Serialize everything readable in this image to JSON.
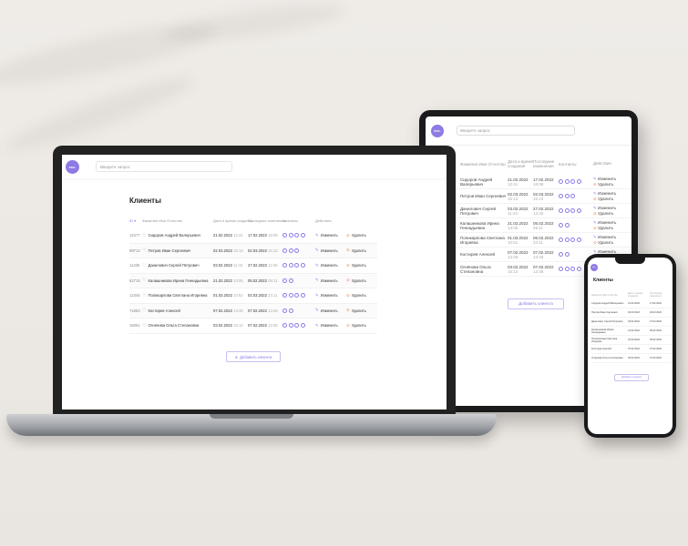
{
  "app": {
    "logo_text": "ecc.",
    "search_placeholder": "Введите запрос",
    "page_title": "Клиенты",
    "add_button_label": "Добавить клиента",
    "accent_color": "#8f7ae4",
    "delete_color": "#e98b6a"
  },
  "laptop": {
    "columns": [
      "ID ▾",
      "Фамилия Имя Отчество",
      "Дата и время создания",
      "Последние изменения",
      "Контакты",
      "Действия"
    ],
    "rows": [
      {
        "id": "12477",
        "name": "Сидоров Андрей Валерьевич",
        "created_date": "21.02.2022",
        "created_time": "12:41",
        "changed_date": "17.02.2022",
        "changed_time": "18:08",
        "edit": "Изменить",
        "delete": "Удалить"
      },
      {
        "id": "98713",
        "name": "Петров Иван Сергеевич",
        "created_date": "02.03.2022",
        "created_time": "15:13",
        "changed_date": "02.03.2022",
        "changed_time": "15:13",
        "edit": "Изменить",
        "delete": "Удалить"
      },
      {
        "id": "11435",
        "name": "Данилович Сергей Петрович",
        "created_date": "03.02.2022",
        "created_time": "11:44",
        "changed_date": "27.02.2022",
        "changed_time": "12:45",
        "edit": "Изменить",
        "delete": "Удалить"
      },
      {
        "id": "62715",
        "name": "Калашникова Ирина Геннадьевна",
        "created_date": "21.02.2022",
        "created_time": "13:05",
        "changed_date": "05.02.2022",
        "changed_time": "09:11",
        "edit": "Изменить",
        "delete": "Удалить"
      },
      {
        "id": "12346",
        "name": "Поликарпова Светлана Игоревна",
        "created_date": "01.03.2022",
        "created_time": "10:51",
        "changed_date": "02.03.2022",
        "changed_time": "23:11",
        "edit": "Изменить",
        "delete": "Удалить"
      },
      {
        "id": "71653",
        "name": "Костирев Алексей",
        "created_date": "07.02.2022",
        "created_time": "13:48",
        "changed_date": "07.02.2022",
        "changed_time": "13:48",
        "edit": "Изменить",
        "delete": "Удалить"
      },
      {
        "id": "15051",
        "name": "Огнёнова Ольга Степановна",
        "created_date": "03.02.2022",
        "created_time": "15:13",
        "changed_date": "07.02.2022",
        "changed_time": "13:38",
        "edit": "Изменить",
        "delete": "Удалить"
      }
    ]
  },
  "tablet": {
    "columns": [
      "Фамилия Имя Отчество",
      "Дата и время создания",
      "Последние изменения",
      "Контакты",
      "Действия"
    ],
    "rows": [
      {
        "name": "Сидоров Андрей Валерьевич",
        "created_date": "21.02.2022",
        "created_time": "12:41",
        "changed_date": "17.02.2022",
        "changed_time": "18:08",
        "edit": "Изменить",
        "delete": "Удалить"
      },
      {
        "name": "Петров Иван Сергеевич",
        "created_date": "02.03.2022",
        "created_time": "15:13",
        "changed_date": "02.03.2022",
        "changed_time": "15:13",
        "edit": "Изменить",
        "delete": "Удалить"
      },
      {
        "name": "Данилович Сергей Петрович",
        "created_date": "03.02.2022",
        "created_time": "11:44",
        "changed_date": "27.02.2022",
        "changed_time": "12:45",
        "edit": "Изменить",
        "delete": "Удалить"
      },
      {
        "name": "Калашникова Ирина Геннадьевна",
        "created_date": "21.02.2022",
        "created_time": "13:05",
        "changed_date": "05.02.2022",
        "changed_time": "09:11",
        "edit": "Изменить",
        "delete": "Удалить"
      },
      {
        "name": "Поликарпова Светлана Игоревна",
        "created_date": "01.03.2022",
        "created_time": "10:51",
        "changed_date": "06.02.2022",
        "changed_time": "23:11",
        "edit": "Изменить",
        "delete": "Удалить"
      },
      {
        "name": "Костирев Алексей",
        "created_date": "07.02.2022",
        "created_time": "13:48",
        "changed_date": "07.02.2022",
        "changed_time": "13:48",
        "edit": "Изменить",
        "delete": "Удалить"
      },
      {
        "name": "Огнёнова Ольга Степановна",
        "created_date": "03.02.2022",
        "created_time": "15:13",
        "changed_date": "07.02.2022",
        "changed_time": "13:38",
        "edit": "Изменить",
        "delete": "Удалить"
      }
    ]
  },
  "phone": {
    "columns": [
      "Фамилия Имя Отчество",
      "Дата и время создания",
      "Последние изменения"
    ],
    "rows": [
      {
        "name": "Сидоров Андрей Валерьевич",
        "created": "21.02.2022",
        "changed": "17.02.2022"
      },
      {
        "name": "Петров Иван Сергеевич",
        "created": "02.03.2022",
        "changed": "02.03.2022"
      },
      {
        "name": "Данилович Сергей Петрович",
        "created": "03.02.2022",
        "changed": "27.02.2022"
      },
      {
        "name": "Калашникова Ирина Геннадьевна",
        "created": "21.02.2022",
        "changed": "05.02.2022"
      },
      {
        "name": "Поликарпова Светлана Игоревна",
        "created": "01.03.2022",
        "changed": "06.02.2022"
      },
      {
        "name": "Костирев Алексей",
        "created": "07.02.2022",
        "changed": "07.02.2022"
      },
      {
        "name": "Огнёнова Ольга Степановна",
        "created": "03.02.2022",
        "changed": "07.02.2022"
      }
    ]
  }
}
